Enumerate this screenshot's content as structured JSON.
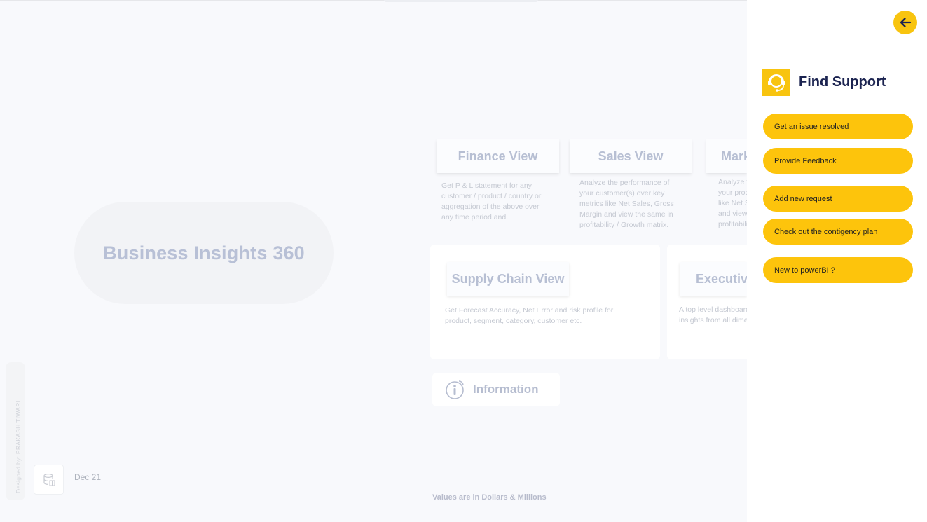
{
  "hero": {
    "title": "Business Insights 360"
  },
  "views": {
    "finance": {
      "label": "Finance View",
      "desc": "Get P & L statement for any customer / product / country or aggregation of the above over any time period and..."
    },
    "sales": {
      "label": "Sales View",
      "desc": "Analyze the performance of your customer(s) over key metrics like Net Sales, Gross Margin and view the same in profitability / Growth matrix."
    },
    "marketing": {
      "label": "Marketing View",
      "desc": "Analyze the performance of your products over key metrics like Net Sales, Gross Margin and view the same in profitability..."
    },
    "supply_chain": {
      "label": "Supply Chain View",
      "desc": "Get Forecast Accuracy, Net Error and risk profile for product, segment, category, customer etc."
    },
    "executive": {
      "label": "Executive View",
      "desc": "A top level dashboard consolidating top insights from all dimensions of business"
    }
  },
  "information": {
    "label": "Information",
    "icon": "info-icon"
  },
  "credit": "Designed by: PRAKASH TIWARI",
  "date": "Dec 21",
  "footnote": "Values are in Dollars & Millions",
  "support_panel": {
    "title": "Find Support",
    "back_icon": "arrow-left-icon",
    "logo_icon": "headset-icon",
    "accent": "#FDC40C",
    "options": [
      {
        "label": "Get an issue resolved"
      },
      {
        "label": "Provide Feedback"
      },
      {
        "label": "Add new request"
      },
      {
        "label": "Check out the contigency plan"
      },
      {
        "label": "New to powerBI ?"
      }
    ]
  }
}
